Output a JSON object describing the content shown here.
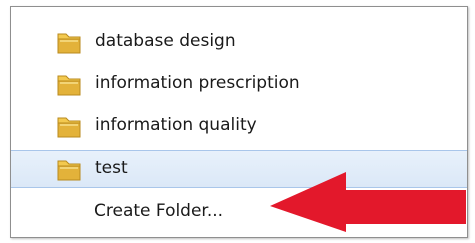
{
  "menu": {
    "items": [
      {
        "label": "database design",
        "icon": "folder-icon"
      },
      {
        "label": "information prescription",
        "icon": "folder-icon"
      },
      {
        "label": "information quality",
        "icon": "folder-icon"
      },
      {
        "label": "test",
        "icon": "folder-icon",
        "selected": true
      }
    ],
    "create_folder_label": "Create Folder..."
  },
  "colors": {
    "folder": "#e3b23a",
    "selection_background": "#dbe8f7",
    "selection_border": "#a9c6ea",
    "arrow": "#e3182b"
  }
}
